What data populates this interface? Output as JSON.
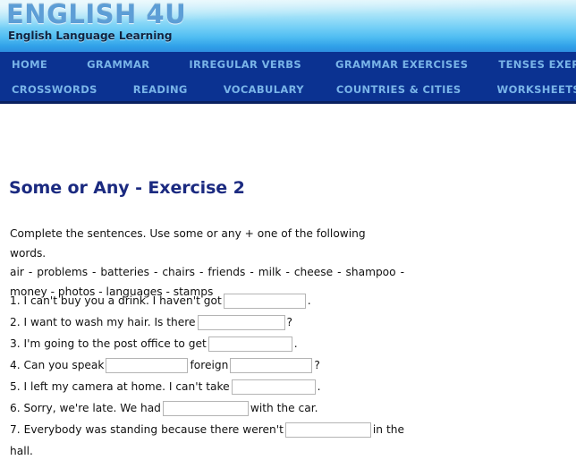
{
  "header": {
    "logo_title": "ENGLISH 4U",
    "logo_subtitle": "English Language Learning",
    "gradient_top_color": "#d8f3fb",
    "gradient_bottom_color": "#2e8fe0",
    "logo_color": "#5d9ed6"
  },
  "nav": {
    "background_color": "#0b3291",
    "link_color": "#79b4e8",
    "row1": [
      {
        "label": "HOME"
      },
      {
        "label": "GRAMMAR"
      },
      {
        "label": "IRREGULAR VERBS"
      },
      {
        "label": "GRAMMAR EXERCISES"
      },
      {
        "label": "TENSES EXERCISES"
      }
    ],
    "row2": [
      {
        "label": "CROSSWORDS"
      },
      {
        "label": "READING"
      },
      {
        "label": "VOCABULARY"
      },
      {
        "label": "COUNTRIES & CITIES"
      },
      {
        "label": "WORKSHEETS"
      }
    ]
  },
  "main": {
    "title": "Some or Any - Exercise 2",
    "title_color": "#1b2a80",
    "instruction": "Complete the sentences. Use some or any + one of the following words.",
    "word_list_line1": "air  -  problems  -  batteries  -  chairs  -  friends  -  milk  -  cheese  -  shampoo  -",
    "word_list_line2": "money - photos - languages - stamps",
    "questions": [
      {
        "number": "1.",
        "before": "1. I can't buy you a drink. I haven't got",
        "after": ".",
        "value": "",
        "mid": ""
      },
      {
        "number": "2.",
        "before": "2. I want to wash my hair. Is there",
        "after": "?",
        "value": "",
        "mid": ""
      },
      {
        "number": "3.",
        "before": "3. I'm going to the post office to get",
        "after": ".",
        "value": "",
        "mid": ""
      },
      {
        "number": "4.",
        "before": "4. Can you speak",
        "mid": "foreign",
        "after": "?",
        "value": "",
        "value2": ""
      },
      {
        "number": "5.",
        "before": "5. I left my camera at home. I can't take",
        "after": ".",
        "value": "",
        "mid": ""
      },
      {
        "number": "6.",
        "before": "6. Sorry, we're late. We had",
        "after": "with the car.",
        "value": "",
        "mid": ""
      },
      {
        "number": "7.",
        "before": "7. Everybody was standing because there weren't",
        "after": "in the hall.",
        "value": "",
        "mid": ""
      }
    ]
  }
}
